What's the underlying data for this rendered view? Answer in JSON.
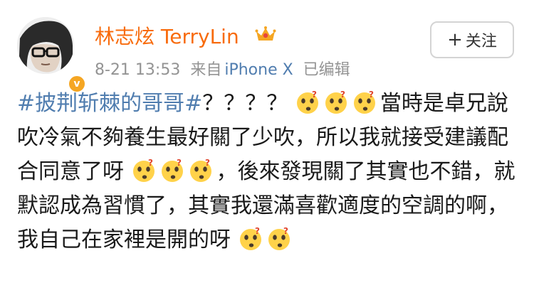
{
  "post": {
    "user_name": "林志炫 TerryLin",
    "date": "8-21 13:53",
    "source_prefix": "来自",
    "source": "iPhone X",
    "edited": "已编辑",
    "follow_label": "关注",
    "follow_plus": "+",
    "verified_badge": "v",
    "avatar_icon": "avatar-photo",
    "crown_icon": "crown-icon",
    "emoji_icon": "doubt-face-emoji",
    "colors": {
      "name": "#f86b0c",
      "hashtag": "#507daf",
      "meta": "#939393",
      "badge": "#f5a623"
    },
    "text": {
      "hashtag": "#披荆斩棘的哥哥#",
      "part1": "？？？？",
      "part2": "當時是卓兄說吹冷氣不夠養生最好關了少吹，所以我就接受建議配合同意了呀",
      "part3": "，後來發現關了其實也不錯，就默認成為習慣了，其實我還滿喜歡適度的空調的啊，我自己在家裡是開的呀"
    }
  }
}
